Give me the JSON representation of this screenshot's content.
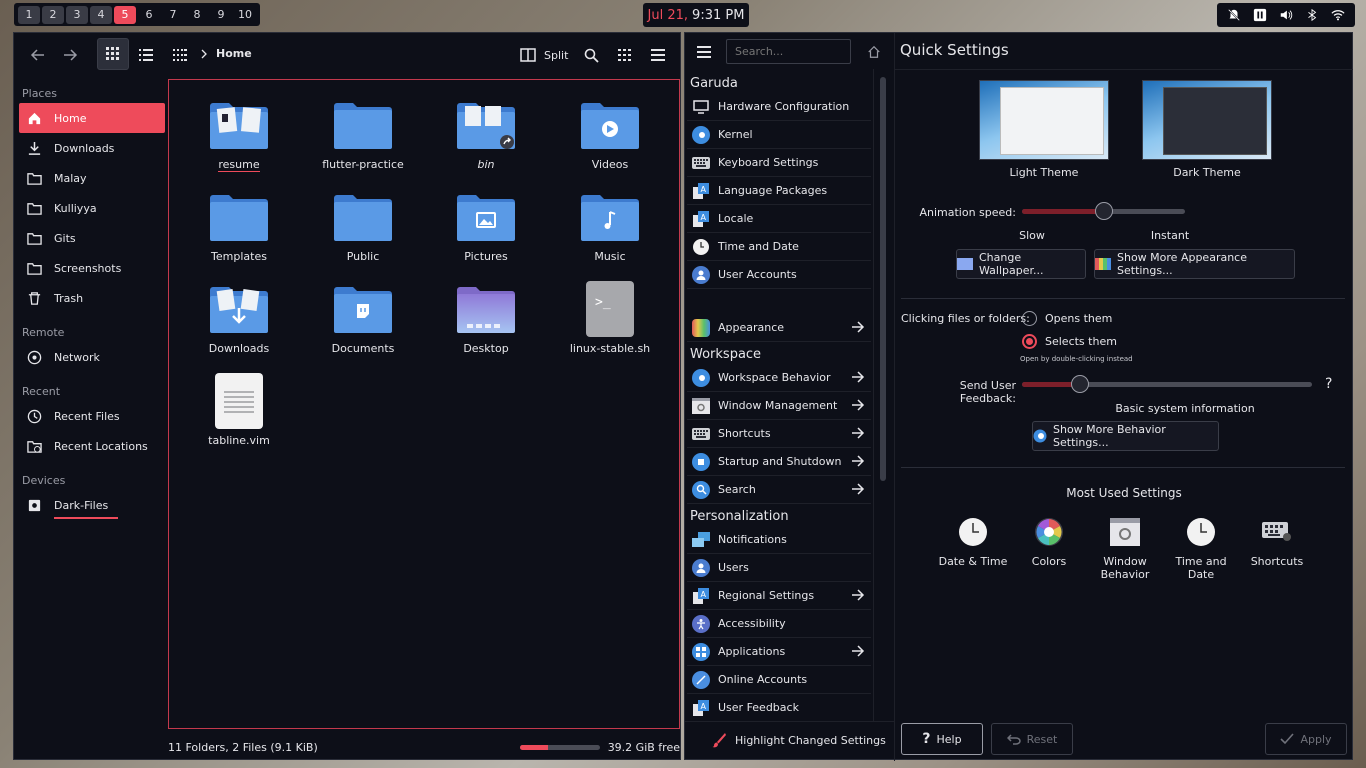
{
  "topbar": {
    "workspaces": [
      "1",
      "2",
      "3",
      "4",
      "5",
      "6",
      "7",
      "8",
      "9",
      "10"
    ],
    "active_workspace": "5",
    "date": "Jul 21,",
    "time": "9:31 PM",
    "tray_icons": [
      "notifications-off-icon",
      "pause-icon",
      "volume-icon",
      "bluetooth-icon",
      "wifi-icon"
    ]
  },
  "dolphin": {
    "toolbar": {
      "breadcrumb": "Home",
      "split_label": "Split"
    },
    "sidebar": {
      "places_heading": "Places",
      "places": [
        {
          "label": "Home",
          "icon": "home-icon"
        },
        {
          "label": "Downloads",
          "icon": "download-icon"
        },
        {
          "label": "Malay",
          "icon": "folder-icon"
        },
        {
          "label": "Kulliyya",
          "icon": "folder-icon"
        },
        {
          "label": "Gits",
          "icon": "folder-icon"
        },
        {
          "label": "Screenshots",
          "icon": "folder-icon"
        },
        {
          "label": "Trash",
          "icon": "trash-icon"
        }
      ],
      "remote_heading": "Remote",
      "remote": [
        {
          "label": "Network",
          "icon": "network-icon"
        }
      ],
      "recent_heading": "Recent",
      "recent": [
        {
          "label": "Recent Files",
          "icon": "clock-icon"
        },
        {
          "label": "Recent Locations",
          "icon": "folder-clock-icon"
        }
      ],
      "devices_heading": "Devices",
      "devices": [
        {
          "label": "Dark-Files",
          "icon": "drive-icon"
        }
      ]
    },
    "files": [
      {
        "name": "resume",
        "kind": "folder-docs"
      },
      {
        "name": "flutter-practice",
        "kind": "folder"
      },
      {
        "name": "bin",
        "kind": "folder-link"
      },
      {
        "name": "Videos",
        "kind": "folder-videos"
      },
      {
        "name": "Templates",
        "kind": "folder"
      },
      {
        "name": "Public",
        "kind": "folder"
      },
      {
        "name": "Pictures",
        "kind": "folder-pictures"
      },
      {
        "name": "Music",
        "kind": "folder-music"
      },
      {
        "name": "Downloads",
        "kind": "folder-downloads"
      },
      {
        "name": "Documents",
        "kind": "folder-documents"
      },
      {
        "name": "Desktop",
        "kind": "folder-desktop"
      },
      {
        "name": "linux-stable.sh",
        "kind": "script"
      },
      {
        "name": "tabline.vim",
        "kind": "text"
      }
    ],
    "status": {
      "summary": "11 Folders, 2 Files (9.1 KiB)",
      "free": "39.2 GiB free",
      "used_fraction": 0.35
    }
  },
  "settings": {
    "search_placeholder": "Search...",
    "title": "Quick Settings",
    "groups": {
      "garuda": "Garuda",
      "garuda_items": [
        {
          "label": "Hardware Configuration",
          "icon": "monitor-icon",
          "arrow": false
        },
        {
          "label": "Kernel",
          "icon": "kernel-icon",
          "arrow": false
        },
        {
          "label": "Keyboard Settings",
          "icon": "keyboard-icon",
          "arrow": false
        },
        {
          "label": "Language Packages",
          "icon": "language-icon",
          "arrow": false
        },
        {
          "label": "Locale",
          "icon": "locale-icon",
          "arrow": false
        },
        {
          "label": "Time and Date",
          "icon": "clock-icon",
          "arrow": false
        },
        {
          "label": "User Accounts",
          "icon": "user-icon",
          "arrow": false
        }
      ],
      "appearance": {
        "label": "Appearance",
        "icon": "appearance-icon",
        "arrow": true
      },
      "workspace": "Workspace",
      "workspace_items": [
        {
          "label": "Workspace Behavior",
          "icon": "workspace-icon",
          "arrow": true
        },
        {
          "label": "Window Management",
          "icon": "window-icon",
          "arrow": true
        },
        {
          "label": "Shortcuts",
          "icon": "keyboard-icon",
          "arrow": true
        },
        {
          "label": "Startup and Shutdown",
          "icon": "startup-icon",
          "arrow": true
        },
        {
          "label": "Search",
          "icon": "search-icon",
          "arrow": true
        }
      ],
      "personalization": "Personalization",
      "personalization_items": [
        {
          "label": "Notifications",
          "icon": "notifications-icon",
          "arrow": false
        },
        {
          "label": "Users",
          "icon": "user-icon",
          "arrow": false
        },
        {
          "label": "Regional Settings",
          "icon": "language-icon",
          "arrow": true
        },
        {
          "label": "Accessibility",
          "icon": "accessibility-icon",
          "arrow": false
        },
        {
          "label": "Applications",
          "icon": "applications-icon",
          "arrow": true
        },
        {
          "label": "Online Accounts",
          "icon": "online-accounts-icon",
          "arrow": false
        },
        {
          "label": "User Feedback",
          "icon": "feedback-icon",
          "arrow": false
        }
      ]
    },
    "highlight_label": "Highlight Changed Settings",
    "themes": {
      "light": "Light Theme",
      "dark": "Dark Theme"
    },
    "animation": {
      "label": "Animation speed:",
      "slow": "Slow",
      "instant": "Instant",
      "value_fraction": 0.5
    },
    "buttons": {
      "wallpaper": "Change Wallpaper...",
      "appearance_more": "Show More Appearance Settings...",
      "behavior_more": "Show More Behavior Settings..."
    },
    "clicking": {
      "label": "Clicking files or folders:",
      "opt_open": "Opens them",
      "opt_select": "Selects them",
      "hint": "Open by double-clicking instead",
      "selected": "Selects them"
    },
    "feedback": {
      "label": "Send User Feedback:",
      "level": "Basic system information",
      "value_fraction": 0.2,
      "help": "?"
    },
    "most_used": {
      "heading": "Most Used Settings",
      "items": [
        {
          "label": "Date & Time",
          "icon": "clock-icon"
        },
        {
          "label": "Colors",
          "icon": "colors-icon"
        },
        {
          "label": "Window Behavior",
          "icon": "window-icon"
        },
        {
          "label": "Time and Date",
          "icon": "clock-icon"
        },
        {
          "label": "Shortcuts",
          "icon": "keyboard-icon"
        }
      ]
    },
    "footer": {
      "help": "Help",
      "reset": "Reset",
      "apply": "Apply"
    },
    "colors": {
      "accent": "#ee4b5b",
      "folder": "#4a8ee0",
      "bg": "#0d0f18"
    }
  }
}
